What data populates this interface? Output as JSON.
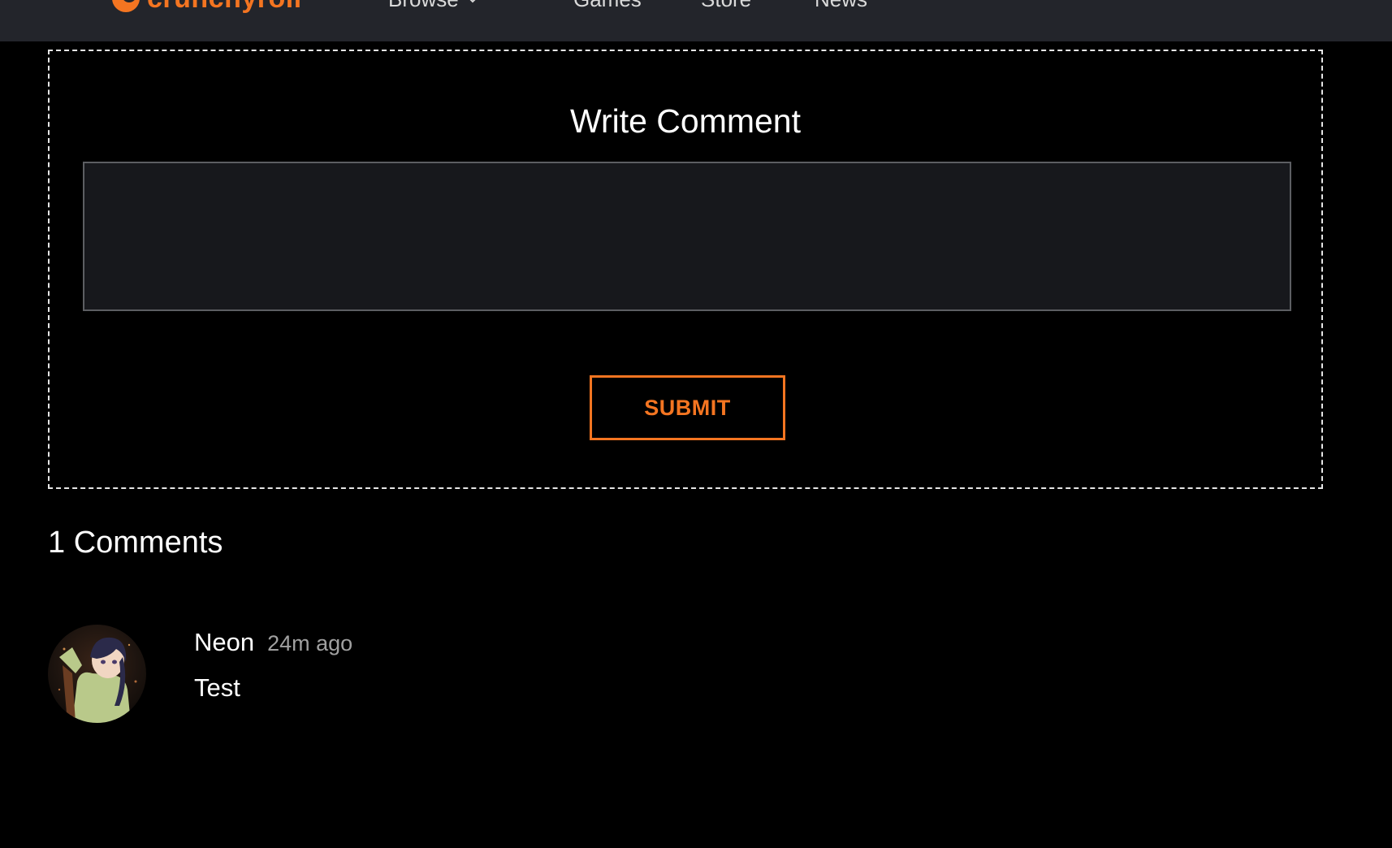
{
  "header": {
    "logo_text": "crunchyroll",
    "logo_icon": "crunchyroll-logo-icon",
    "nav": [
      {
        "label": "Browse",
        "has_dropdown": true
      },
      {
        "label": "Games"
      },
      {
        "label": "Store"
      },
      {
        "label": "News"
      }
    ]
  },
  "comment_form": {
    "title": "Write Comment",
    "input_value": "",
    "input_placeholder": "",
    "submit_label": "SUBMIT"
  },
  "comments": {
    "count_label": "1 Comments",
    "items": [
      {
        "author": "Neon",
        "time": "24m ago",
        "text": "Test",
        "avatar": "user-avatar"
      }
    ]
  },
  "colors": {
    "accent": "#f47521",
    "background": "#000000",
    "navbar": "#23252b",
    "input_bg": "#17181c",
    "muted_text": "#a0a0a0"
  }
}
